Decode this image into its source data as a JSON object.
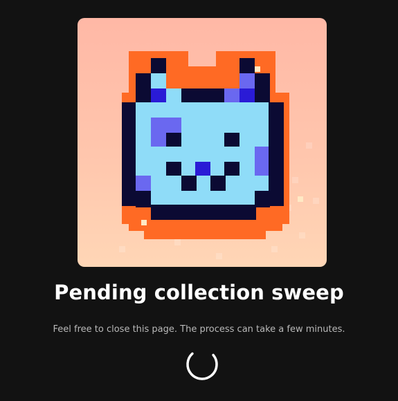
{
  "artwork": {
    "alt": "Pixel art cat NFT"
  },
  "title": "Pending collection sweep",
  "subtitle": "Feel free to close this page. The process can take a few minutes.",
  "colors": {
    "background": "#121212",
    "title": "#ffffff",
    "subtitle": "#b9b9b9",
    "spinner": "#ffffff"
  }
}
